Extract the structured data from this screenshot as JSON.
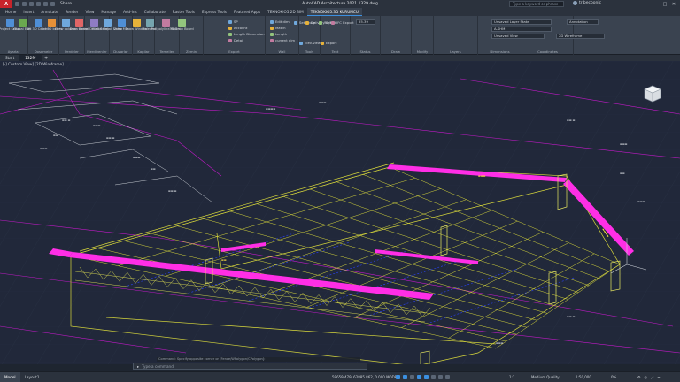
{
  "app": {
    "badge": "A",
    "share": "Share",
    "title": "AutoCAD Architecture 2021   1329.dwg",
    "search_placeholder": "Type a keyword or phrase",
    "user": "tribecoonic"
  },
  "ribbon_tabs": [
    "Home",
    "Insert",
    "Annotate",
    "Render",
    "View",
    "Manage",
    "Add-ins",
    "Collaborate",
    "Raster Tools",
    "Express Tools",
    "Featured Apps",
    "TEKNOKIO5.2D BIM",
    "TEKNOKIO5.3D KURUMCU"
  ],
  "active_tab_index": 12,
  "ribbon": {
    "groups": [
      {
        "label": "Ayarlar"
      },
      {
        "label": "Dosemeler"
      },
      {
        "label": "Perdeler"
      },
      {
        "label": "Merdivenler"
      },
      {
        "label": "Duvarlar"
      },
      {
        "label": "Kapilar"
      },
      {
        "label": "Temeller"
      },
      {
        "label": "Zemin"
      },
      {
        "label": "Export"
      },
      {
        "label": "Wall"
      },
      {
        "label": "Tools"
      },
      {
        "label": "Text"
      },
      {
        "label": "Status"
      },
      {
        "label": "Draw"
      },
      {
        "label": "Modify"
      },
      {
        "label": "Layers"
      },
      {
        "label": "Dimensions"
      },
      {
        "label": "Coordinates"
      }
    ],
    "big_buttons": [
      "Project Setup",
      "Global Edit",
      "Set 3D Column",
      "Set 3D beam",
      "Draw column",
      "Draw beam",
      "Global Detail Setup",
      "Global Detail Video",
      "Draw MEs",
      "Draw Window",
      "Selected",
      "Put polyline Model",
      "3D Draw Board"
    ],
    "small_items": [
      "SP",
      "Account",
      "Length Dimension",
      "Detail",
      "Edit dim",
      "Match",
      "Length",
      "current dim",
      "Set group",
      "Delivery batch",
      "3D/BIM",
      "IFC Export",
      "Elev.View",
      "Export"
    ],
    "layer_dropdown_1": "Unsaved Layer State",
    "layer_dropdown_2": "A-SHM",
    "view_dropdown": "Unsaved View",
    "visual_style": "2D Wireframe",
    "annotation_value": "Annotation",
    "scale_value": "55.39"
  },
  "file_tabs": [
    "Start",
    "1329*"
  ],
  "active_file_index": 1,
  "viewport": {
    "label": "[-] Custom View] [2D Wireframe]"
  },
  "command": {
    "history": "Command: Specify opposite corner or [Fence/WPolygon/CPolygon]:",
    "placeholder": "Type a command"
  },
  "status": {
    "layout_tabs": [
      "Model",
      "Layout1"
    ],
    "active_layout_index": 0,
    "coords": "59659.479, 62885.862, 0.000  MODEL",
    "annotation_scale": "1:1",
    "quality": "Medium Quality",
    "scale2": "1:50,000",
    "percent": "0%"
  },
  "colors": {
    "magenta": "#ff1cff",
    "yellow": "#e6e64a",
    "blue": "#2a3cf0",
    "white_lines": "#d8dde4",
    "pink_slab": "#ff33ff"
  }
}
